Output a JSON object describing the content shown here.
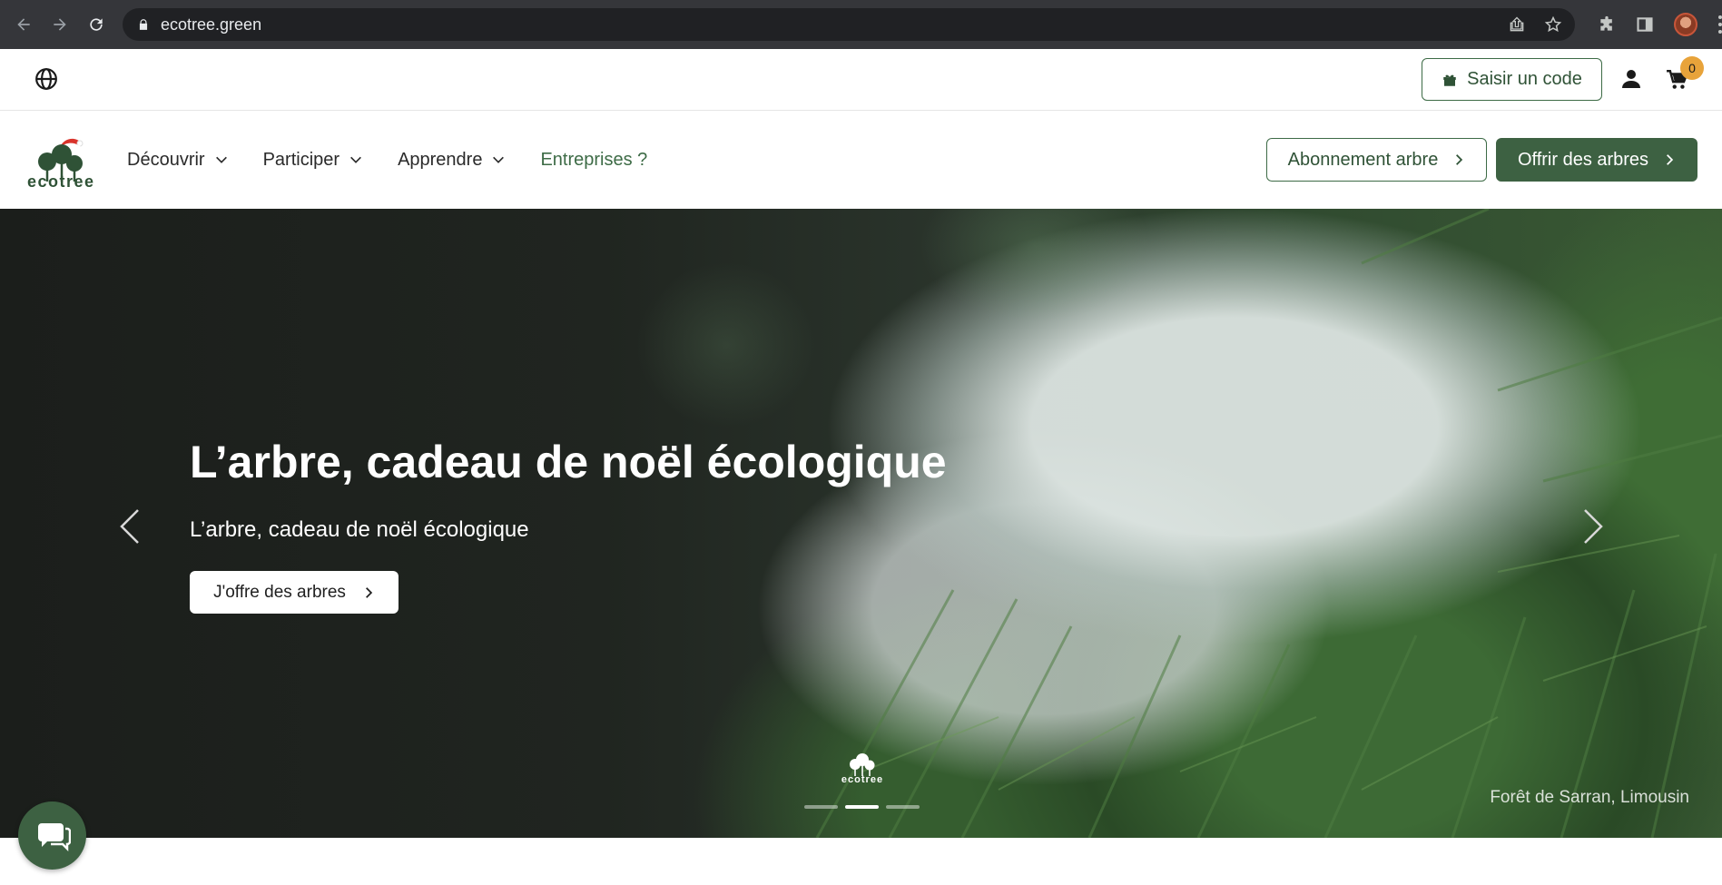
{
  "browser": {
    "url": "ecotree.green"
  },
  "topbar": {
    "code_button": "Saisir un code",
    "cart_count": "0"
  },
  "nav": {
    "logo_text": "ecotree",
    "items": [
      {
        "label": "Découvrir"
      },
      {
        "label": "Participer"
      },
      {
        "label": "Apprendre"
      },
      {
        "label": "Entreprises ?"
      }
    ],
    "subscription_button": "Abonnement arbre",
    "gift_button": "Offrir des arbres"
  },
  "hero": {
    "title": "L’arbre, cadeau de noël écologique",
    "subtitle": "L’arbre, cadeau de noël écologique",
    "cta": "J'offre des arbres",
    "logo_text": "ecotree",
    "caption": "Forêt de Sarran, Limousin",
    "active_slide": 2,
    "slide_count": 3
  },
  "colors": {
    "brand_green": "#3d6142",
    "badge": "#e8a33a"
  }
}
